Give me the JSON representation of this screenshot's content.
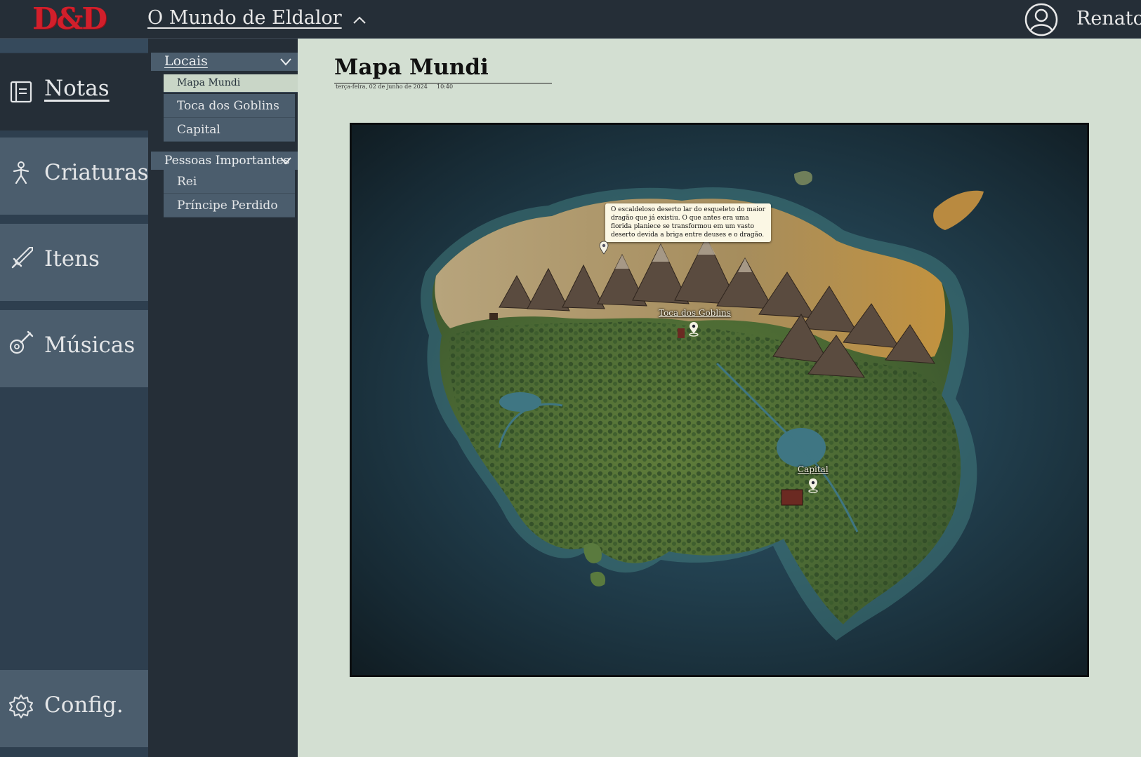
{
  "header": {
    "logo": "D&D",
    "world_title": "O Mundo de Eldalor",
    "user_name": "Renato"
  },
  "sidebar": {
    "items": [
      {
        "label": "Notas",
        "icon": "notes-icon"
      },
      {
        "label": "Criaturas",
        "icon": "creature-icon"
      },
      {
        "label": "Itens",
        "icon": "sword-icon"
      },
      {
        "label": "Músicas",
        "icon": "guitar-icon"
      }
    ],
    "config": {
      "label": "Config.",
      "icon": "gear-icon"
    }
  },
  "notes_tree": {
    "groups": [
      {
        "label": "Locais",
        "items": [
          "Mapa Mundi",
          "Toca dos Goblins",
          "Capital"
        ]
      },
      {
        "label": "Pessoas Importantes",
        "items": [
          "Rei",
          "Príncipe Perdido"
        ]
      }
    ]
  },
  "note": {
    "title": "Mapa Mundi",
    "date": "terça-feira, 02 de junho de 2024",
    "time": "10:40"
  },
  "map": {
    "tooltip": "O escaldeloso deserto lar do esqueleto do maior dragão que já existiu. O que antes era uma florida planiece se transformou em um vasto deserto devida a briga entre deuses e o dragão.",
    "markers": [
      {
        "label": "Toca dos Goblins"
      },
      {
        "label": "Capital"
      }
    ]
  },
  "colors": {
    "topbar": "#252e37",
    "sidebar": "#2e3f4f",
    "nav_item": "#4b5d6d",
    "page_bg": "#d3dfd2",
    "logo_red": "#d21f2b"
  }
}
